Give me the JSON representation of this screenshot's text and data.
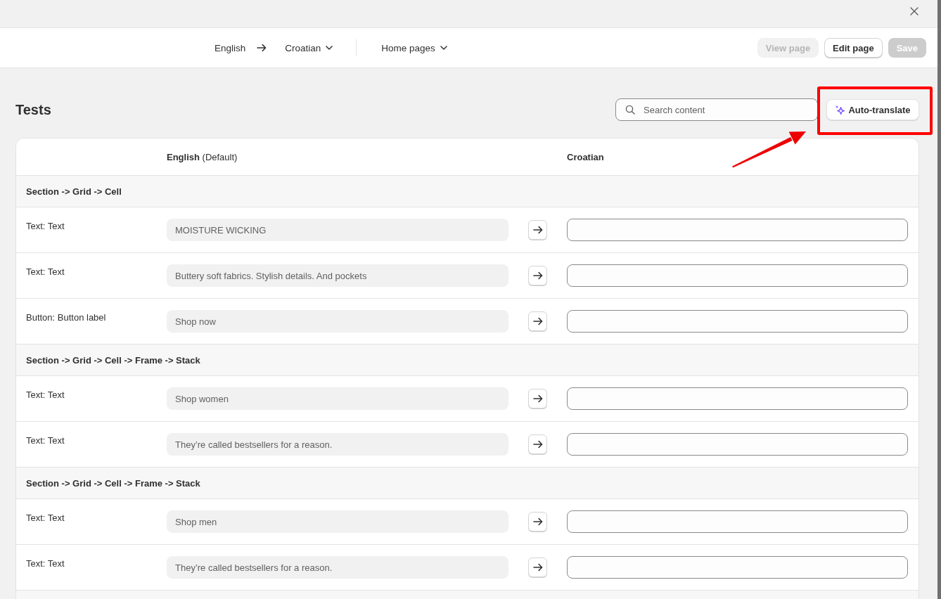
{
  "header": {
    "source_language": "English",
    "target_language": "Croatian",
    "resource_type": "Home pages",
    "buttons": [
      {
        "label": "View page",
        "kind": "secondary",
        "disabled": true
      },
      {
        "label": "Edit page",
        "kind": "secondary",
        "disabled": false
      },
      {
        "label": "Save",
        "kind": "primary",
        "disabled": true
      }
    ]
  },
  "page": {
    "title": "Tests",
    "search": {
      "placeholder": "Search content"
    },
    "auto_translate": {
      "label": "Auto-translate",
      "highlighted": true
    }
  },
  "table": {
    "columns": [
      {
        "label": "English",
        "note": "(Default)"
      },
      {
        "label": "Croatian"
      }
    ],
    "groups": [
      {
        "title": "Section -> Grid -> Cell",
        "rows": [
          {
            "field": "Text: Text",
            "source": "MOISTURE WICKING"
          },
          {
            "field": "Text: Text",
            "source": "Buttery soft fabrics. Stylish details. And pockets"
          },
          {
            "field": "Button: Button label",
            "source": "Shop now"
          }
        ]
      },
      {
        "title": "Section -> Grid -> Cell -> Frame -> Stack",
        "rows": [
          {
            "field": "Text: Text",
            "source": "Shop women"
          },
          {
            "field": "Text: Text",
            "source": "They’re called bestsellers for a reason."
          }
        ]
      },
      {
        "title": "Section -> Grid -> Cell -> Frame -> Stack",
        "rows": [
          {
            "field": "Text: Text",
            "source": "Shop men"
          },
          {
            "field": "Text: Text",
            "source": "They’re called bestsellers for a reason."
          }
        ]
      }
    ]
  }
}
